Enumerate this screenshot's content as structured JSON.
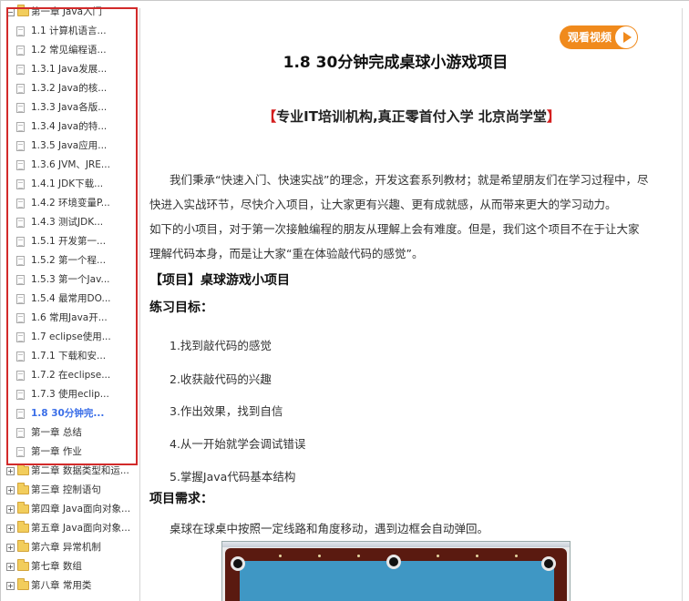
{
  "sidebar": {
    "rows": [
      {
        "type": "chapter",
        "expander": "−",
        "label": "第一章 Java入门"
      },
      {
        "type": "leaf",
        "label": "1.1 计算机语言..."
      },
      {
        "type": "leaf",
        "label": "1.2 常见编程语..."
      },
      {
        "type": "leaf",
        "label": "1.3.1 Java发展..."
      },
      {
        "type": "leaf",
        "label": "1.3.2 Java的核..."
      },
      {
        "type": "leaf",
        "label": "1.3.3 Java各版..."
      },
      {
        "type": "leaf",
        "label": "1.3.4 Java的特..."
      },
      {
        "type": "leaf",
        "label": "1.3.5 Java应用..."
      },
      {
        "type": "leaf",
        "label": "1.3.6 JVM、JRE..."
      },
      {
        "type": "leaf",
        "label": "1.4.1 JDK下载..."
      },
      {
        "type": "leaf",
        "label": "1.4.2 环境变量P..."
      },
      {
        "type": "leaf",
        "label": "1.4.3 测试JDK..."
      },
      {
        "type": "leaf",
        "label": "1.5.1 开发第一..."
      },
      {
        "type": "leaf",
        "label": "1.5.2 第一个程..."
      },
      {
        "type": "leaf",
        "label": "1.5.3 第一个Jav..."
      },
      {
        "type": "leaf",
        "label": "1.5.4 最常用DO..."
      },
      {
        "type": "leaf",
        "label": "1.6 常用Java开..."
      },
      {
        "type": "leaf",
        "label": "1.7 eclipse使用..."
      },
      {
        "type": "leaf",
        "label": "1.7.1 下载和安..."
      },
      {
        "type": "leaf",
        "label": "1.7.2 在eclipse..."
      },
      {
        "type": "leaf",
        "label": "1.7.3 使用eclip..."
      },
      {
        "type": "leaf",
        "label": "1.8 30分钟完...",
        "active": true
      },
      {
        "type": "leaf",
        "label": "第一章 总结"
      },
      {
        "type": "leaf",
        "label": "第一章 作业"
      },
      {
        "type": "chapter",
        "expander": "+",
        "label": "第二章 数据类型和运..."
      },
      {
        "type": "chapter",
        "expander": "+",
        "label": "第三章 控制语句"
      },
      {
        "type": "chapter",
        "expander": "+",
        "label": "第四章 Java面向对象..."
      },
      {
        "type": "chapter",
        "expander": "+",
        "label": "第五章 Java面向对象..."
      },
      {
        "type": "chapter",
        "expander": "+",
        "label": "第六章 异常机制"
      },
      {
        "type": "chapter",
        "expander": "+",
        "label": "第七章 数组"
      },
      {
        "type": "chapter",
        "expander": "+",
        "label": "第八章 常用类"
      }
    ]
  },
  "content": {
    "video_button": "观看视频",
    "title": "1.8 30分钟完成桌球小游戏项目",
    "slogan_open": "【",
    "slogan_text": "专业IT培训机构,真正零首付入学 北京尚学堂",
    "slogan_close": "】",
    "intro1": "我们秉承“快速入门、快速实战”的理念，开发这套系列教材；就是希望朋友们在学习过程中，尽快进入实战环节，尽快介入项目，让大家更有兴趣、更有成就感，从而带来更大的学习动力。",
    "intro2": "如下的小项目，对于第一次接触编程的朋友从理解上会有难度。但是，我们这个项目不在于让大家理解代码本身，而是让大家“重在体验敲代码的感觉”。",
    "project_heading": "【项目】桌球游戏小项目",
    "goals_heading": "练习目标：",
    "goals": [
      "1.找到敲代码的感觉",
      "2.收获敲代码的兴趣",
      "3.作出效果，找到自信",
      "4.从一开始就学会调试错误",
      "5.掌握Java代码基本结构"
    ],
    "requirements_heading": "项目需求：",
    "requirements_text": "桌球在球桌中按照一定线路和角度移动，遇到边框会自动弹回。"
  },
  "colors": {
    "accent_orange": "#f08a1c",
    "highlight_red": "#d22a2a",
    "active_link": "#3a6ee8",
    "slogan_bracket": "#d41f1f",
    "table_felt": "#3f97c4",
    "table_rail": "#5a1a10"
  },
  "icons": {
    "folder": "folder-icon",
    "page": "page-icon",
    "play": "play-icon"
  }
}
